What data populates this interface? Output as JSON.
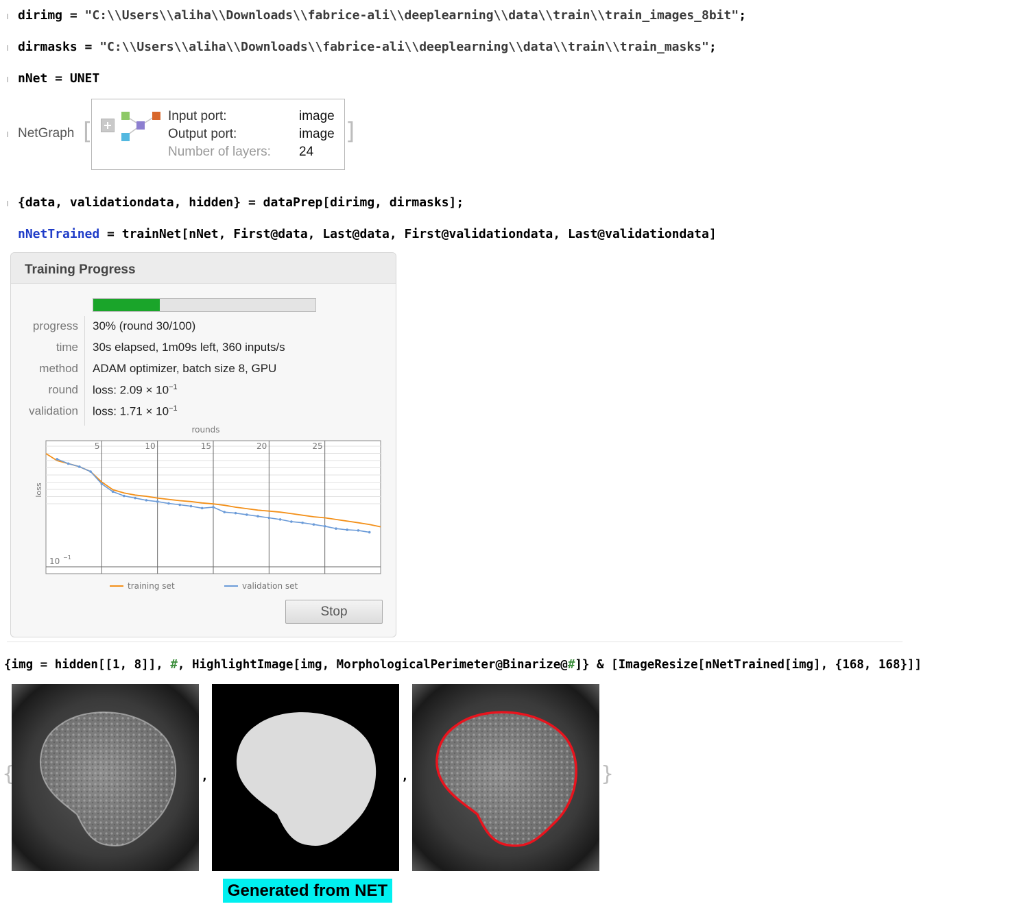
{
  "cells": {
    "line1": {
      "var": "dirimg",
      "op": " = ",
      "value": "\"C:\\\\Users\\\\aliha\\\\Downloads\\\\fabrice-ali\\\\deeplearning\\\\data\\\\train\\\\train_images_8bit\"",
      "end": ";"
    },
    "line2": {
      "var": "dirmasks",
      "op": " = ",
      "value": "\"C:\\\\Users\\\\aliha\\\\Downloads\\\\fabrice-ali\\\\deeplearning\\\\data\\\\train\\\\train_masks\"",
      "end": ";"
    },
    "line3": {
      "text": "nNet = UNET"
    },
    "netgraph": {
      "head": "NetGraph",
      "rows": [
        {
          "label": "Input port:",
          "value": "image"
        },
        {
          "label": "Output port:",
          "value": "image"
        },
        {
          "label": "Number of layers:",
          "value": "24"
        }
      ]
    },
    "line4": {
      "text": "{data, validationdata, hidden} = dataPrep[dirimg, dirmasks];"
    },
    "line5": {
      "var": "nNetTrained",
      "rest": " = trainNet[nNet, First@data, Last@data, First@validationdata, Last@validationdata]"
    },
    "line6": {
      "p1": "{img = hidden[[1, 8]], ",
      "slot": "#",
      "p2": ", HighlightImage[img, MorphologicalPerimeter@Binarize@",
      "p3": "]} & [ImageResize[nNetTrained[img], {168, 168}]]"
    }
  },
  "training": {
    "title": "Training Progress",
    "progress_fraction": 0.3,
    "rows": [
      {
        "label": "progress",
        "value": "30% (round 30/100)"
      },
      {
        "label": "time",
        "value": "30s elapsed, 1m09s left, 360 inputs/s"
      },
      {
        "label": "method",
        "value": "ADAM optimizer, batch size 8, GPU"
      },
      {
        "label": "round",
        "value": "loss: 2.09 × 10",
        "exp": "−1"
      },
      {
        "label": "validation",
        "value": "loss: 1.71 × 10",
        "exp": "−1"
      }
    ],
    "stop_label": "Stop",
    "colors": {
      "progress": "#1aa52a",
      "training": "#f39019",
      "validation": "#6b9bd8"
    }
  },
  "chart_data": {
    "type": "line",
    "xlabel": "rounds",
    "ylabel": "loss",
    "xticks": [
      "5",
      "10",
      "15",
      "20",
      "25"
    ],
    "ytick_label": "10",
    "ytick_exp": "−1",
    "xlim": [
      0,
      30
    ],
    "ylim": [
      0.1,
      0.4
    ],
    "yscale": "log",
    "series": [
      {
        "name": "training set",
        "x": [
          0,
          1,
          2,
          3,
          4,
          5,
          6,
          7,
          8,
          9,
          10,
          11,
          12,
          13,
          14,
          15,
          16,
          17,
          18,
          19,
          20,
          21,
          22,
          23,
          24,
          25,
          26,
          27,
          28,
          29,
          30
        ],
        "values": [
          0.35,
          0.325,
          0.315,
          0.305,
          0.29,
          0.26,
          0.24,
          0.232,
          0.227,
          0.224,
          0.22,
          0.217,
          0.214,
          0.212,
          0.209,
          0.207,
          0.204,
          0.2,
          0.197,
          0.194,
          0.192,
          0.19,
          0.187,
          0.184,
          0.181,
          0.179,
          0.176,
          0.173,
          0.17,
          0.167,
          0.163
        ]
      },
      {
        "name": "validation set",
        "x": [
          1,
          2,
          3,
          4,
          5,
          6,
          7,
          8,
          9,
          10,
          11,
          12,
          13,
          14,
          15,
          16,
          17,
          18,
          19,
          20,
          21,
          22,
          23,
          24,
          25,
          26,
          27,
          28,
          29
        ],
        "values": [
          0.33,
          0.315,
          0.305,
          0.29,
          0.255,
          0.235,
          0.225,
          0.22,
          0.215,
          0.212,
          0.208,
          0.205,
          0.202,
          0.198,
          0.2,
          0.19,
          0.188,
          0.185,
          0.182,
          0.179,
          0.176,
          0.172,
          0.17,
          0.167,
          0.164,
          0.16,
          0.158,
          0.157,
          0.154
        ]
      }
    ],
    "legend": "bottom"
  },
  "images": {
    "caption": "Generated from NET",
    "separator": ","
  }
}
